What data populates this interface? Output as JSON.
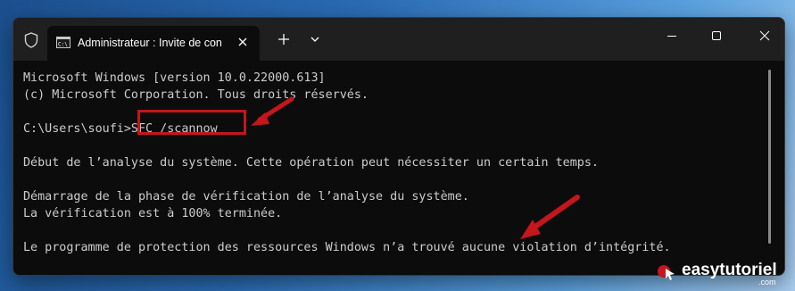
{
  "tab": {
    "title": "Administrateur : Invite de con",
    "icon": "command-prompt-icon"
  },
  "terminal": {
    "lines": [
      "Microsoft Windows [version 10.0.22000.613]",
      "(c) Microsoft Corporation. Tous droits réservés.",
      "",
      "C:\\Users\\soufi>SFC /scannow",
      "",
      "Début de l’analyse du système. Cette opération peut nécessiter un certain temps.",
      "",
      "Démarrage de la phase de vérification de l’analyse du système.",
      "La vérification est à 100% terminée.",
      "",
      "Le programme de protection des ressources Windows n’a trouvé aucune violation d’intégrité."
    ]
  },
  "colors": {
    "terminal_bg": "#0c0c0c",
    "terminal_text": "#cccccc",
    "titlebar_bg": "#1f1f1f",
    "annotation_red": "#c4161c"
  },
  "watermark": {
    "brand": "easytutoriel",
    "suffix": ".com"
  }
}
